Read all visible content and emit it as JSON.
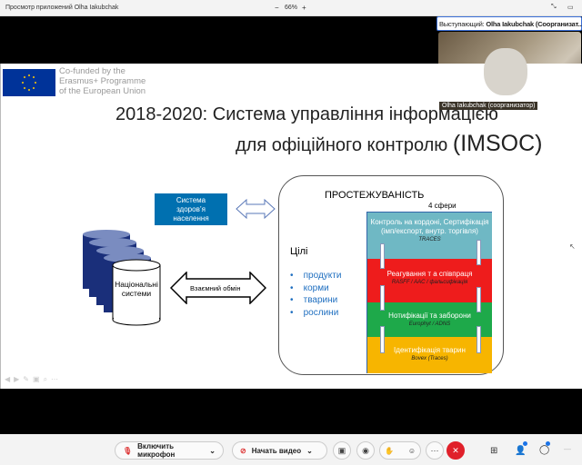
{
  "window": {
    "title": "Просмотр приложений Olha Iakubchak",
    "zoom": "66%",
    "zoom_out": "−",
    "zoom_in": "+"
  },
  "speaker": {
    "label": "Выступающий: ",
    "name": "Olha Iakubchak (Соорганизат...",
    "video_caption": "Olha Iakubchak (соорганизатор)"
  },
  "slide": {
    "logo_text": [
      "Co-funded by the",
      "Erasmus+ Programme",
      "of the European Union"
    ],
    "title_line1": "2018-2020: Система управління інформацією",
    "title_line2": "для офіційного контролю",
    "title_acronym": "(IMSOC)",
    "health_box": "Система здоров’я населення",
    "national_systems": "Національні системи",
    "exchange": "Взаємний обмін",
    "traceability": "ПРОСТЕЖУВАНІСТЬ",
    "spheres": "4 сфери",
    "goals_title": "Цілі",
    "goals": [
      "продукти",
      "корми",
      "тварини",
      "рослини"
    ],
    "bands": [
      {
        "text": "Контроль на кордоні, Сертифікація (імп/експорт, внутр. торгівля)",
        "sub": "TRACES",
        "color": "#6fb8c4"
      },
      {
        "text": "Реагування т а співпраця",
        "sub": "RASFF / AAC / фальсифікація",
        "color": "#ee1c1c"
      },
      {
        "text": "Нотифікації та заборони",
        "sub": "Europhyt / ADNS",
        "color": "#1ea94a"
      },
      {
        "text": "Ідентифікація тварин",
        "sub": "Bovex (Traces)",
        "color": "#f7b500"
      }
    ]
  },
  "toolbar": {
    "mic": "Включить микрофон",
    "video": "Начать видео"
  },
  "colors": {
    "eu_blue": "#003399",
    "health_blue": "#0070b0",
    "leave_red": "#e0202a"
  }
}
